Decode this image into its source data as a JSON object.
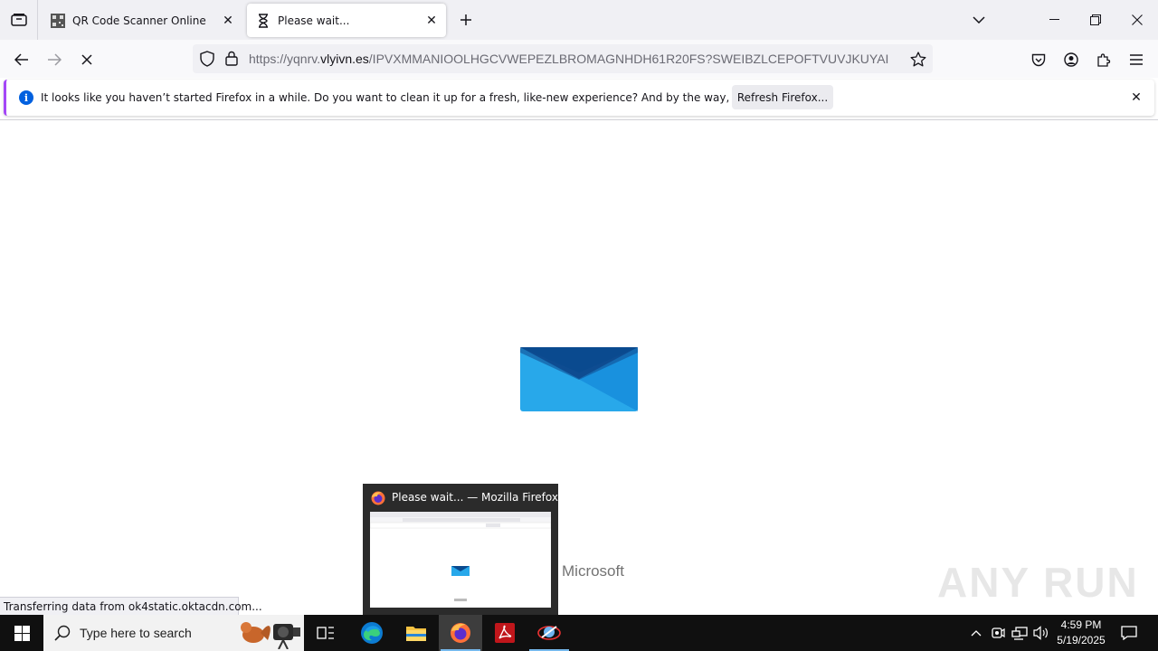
{
  "tabs": [
    {
      "title": "QR Code Scanner Online",
      "favicon": "qr-code-icon",
      "active": false
    },
    {
      "title": "Please wait...",
      "favicon": "hourglass-icon",
      "active": true
    }
  ],
  "urlbar": {
    "url_prefix": "https://yqnrv.",
    "url_domain": "vlyivn.es",
    "url_path": "/IPVXMMANIOOLHGCVWEPEZLBROMAGNHDH61R20FS?SWEIBZLCEPOFTVUVJKUYAI"
  },
  "notification": {
    "message": "It looks like you haven’t started Firefox in a while. Do you want to clean it up for a fresh, like-new experience? And by the way, welcome back!",
    "button": "Refresh Firefox..."
  },
  "page": {
    "brand": "Microsoft",
    "accent_blue": "#1ba1e2",
    "dark_blue": "#0a3d7a"
  },
  "status_text": "Transferring data from ok4static.oktacdn.com...",
  "thumbnail": {
    "title": "Please wait... — Mozilla Firefox"
  },
  "taskbar": {
    "search_placeholder": "Type here to search",
    "time": "4:59 PM",
    "date": "5/19/2025"
  },
  "watermark": "ANY RUN"
}
